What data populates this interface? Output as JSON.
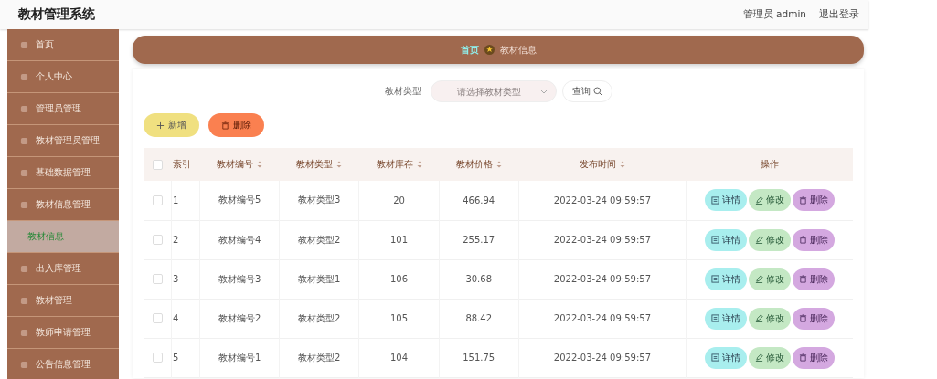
{
  "header": {
    "title": "教材管理系统",
    "user": "管理员 admin",
    "logout": "退出登录"
  },
  "sidebar": {
    "items": [
      {
        "label": "首页",
        "selected": false
      },
      {
        "label": "个人中心",
        "selected": false
      },
      {
        "label": "管理员管理",
        "selected": false
      },
      {
        "label": "教材管理员管理",
        "selected": false
      },
      {
        "label": "基础数据管理",
        "selected": false
      },
      {
        "label": "教材信息管理",
        "selected": false,
        "children": [
          {
            "label": "教材信息",
            "selected": true
          }
        ]
      },
      {
        "label": "出入库管理",
        "selected": false
      },
      {
        "label": "教材管理",
        "selected": false
      },
      {
        "label": "教师申请管理",
        "selected": false
      },
      {
        "label": "公告信息管理",
        "selected": false
      }
    ]
  },
  "breadcrumb": [
    "首页",
    "教材信息"
  ],
  "search": {
    "label": "教材类型",
    "placeholder": "请选择教材类型",
    "button": "查询"
  },
  "actions": {
    "add": "新增",
    "delete": "删除"
  },
  "table": {
    "all_checked": false,
    "columns": [
      "索引",
      "教材编号",
      "教材类型",
      "教材库存",
      "教材价格",
      "发布时间",
      "操作"
    ],
    "rows": [
      {
        "checked": false,
        "cells": [
          "1",
          "教材编号5",
          "教材类型3",
          "20",
          "466.94",
          "2022-03-24 09:59:57"
        ],
        "buttons": [
          "详情",
          "修改",
          "删除"
        ]
      },
      {
        "checked": false,
        "cells": [
          "2",
          "教材编号4",
          "教材类型2",
          "101",
          "255.17",
          "2022-03-24 09:59:57"
        ],
        "buttons": [
          "详情",
          "修改",
          "删除"
        ]
      },
      {
        "checked": false,
        "cells": [
          "3",
          "教材编号3",
          "教材类型1",
          "106",
          "30.68",
          "2022-03-24 09:59:57"
        ],
        "buttons": [
          "详情",
          "修改",
          "删除"
        ]
      },
      {
        "checked": false,
        "cells": [
          "4",
          "教材编号2",
          "教材类型2",
          "105",
          "88.42",
          "2022-03-24 09:59:57"
        ],
        "buttons": [
          "详情",
          "修改",
          "删除"
        ]
      },
      {
        "checked": false,
        "cells": [
          "5",
          "教材编号1",
          "教材类型2",
          "104",
          "151.75",
          "2022-03-24 09:59:57"
        ],
        "buttons": [
          "详情",
          "修改",
          "删除"
        ]
      }
    ]
  }
}
